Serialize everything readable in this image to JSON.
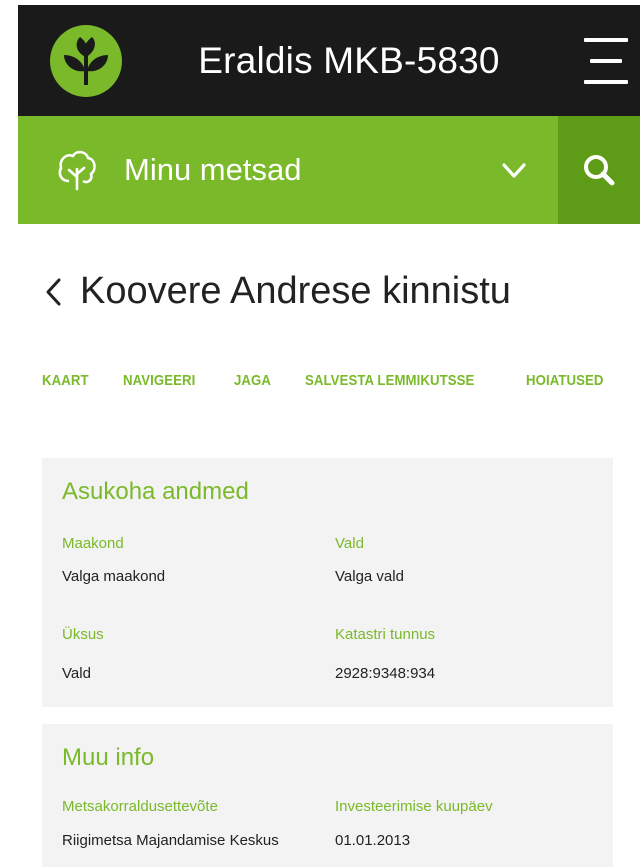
{
  "header": {
    "title": "Eraldis MKB-5830"
  },
  "forest_bar": {
    "label": "Minu metsad"
  },
  "page": {
    "back_title": "Koovere Andrese kinnistu"
  },
  "actions": [
    "KAART",
    "NAVIGEERI",
    "JAGA",
    "SALVESTA LEMMIKUTSSE",
    "HOIATUSED"
  ],
  "location": {
    "title": "Asukoha andmed",
    "county_label": "Maakond",
    "county_value": "Valga maakond",
    "parish_label": "Vald",
    "parish_value": "Valga vald",
    "unit_label": "Üksus",
    "unit_value": "Vald",
    "cadastre_label": "Katastri tunnus",
    "cadastre_value": "2928:9348:934"
  },
  "other": {
    "title": "Muu info",
    "company_label": "Metsakorraldusettevõte",
    "company_value": "Riigimetsa Majandamise Keskus",
    "date_label": "Investeerimise kuupäev",
    "date_value": "01.01.2013"
  },
  "colors": {
    "brand_green": "#7ab929",
    "dark_green": "#5e9b17",
    "header_black": "#1a1a1a"
  }
}
